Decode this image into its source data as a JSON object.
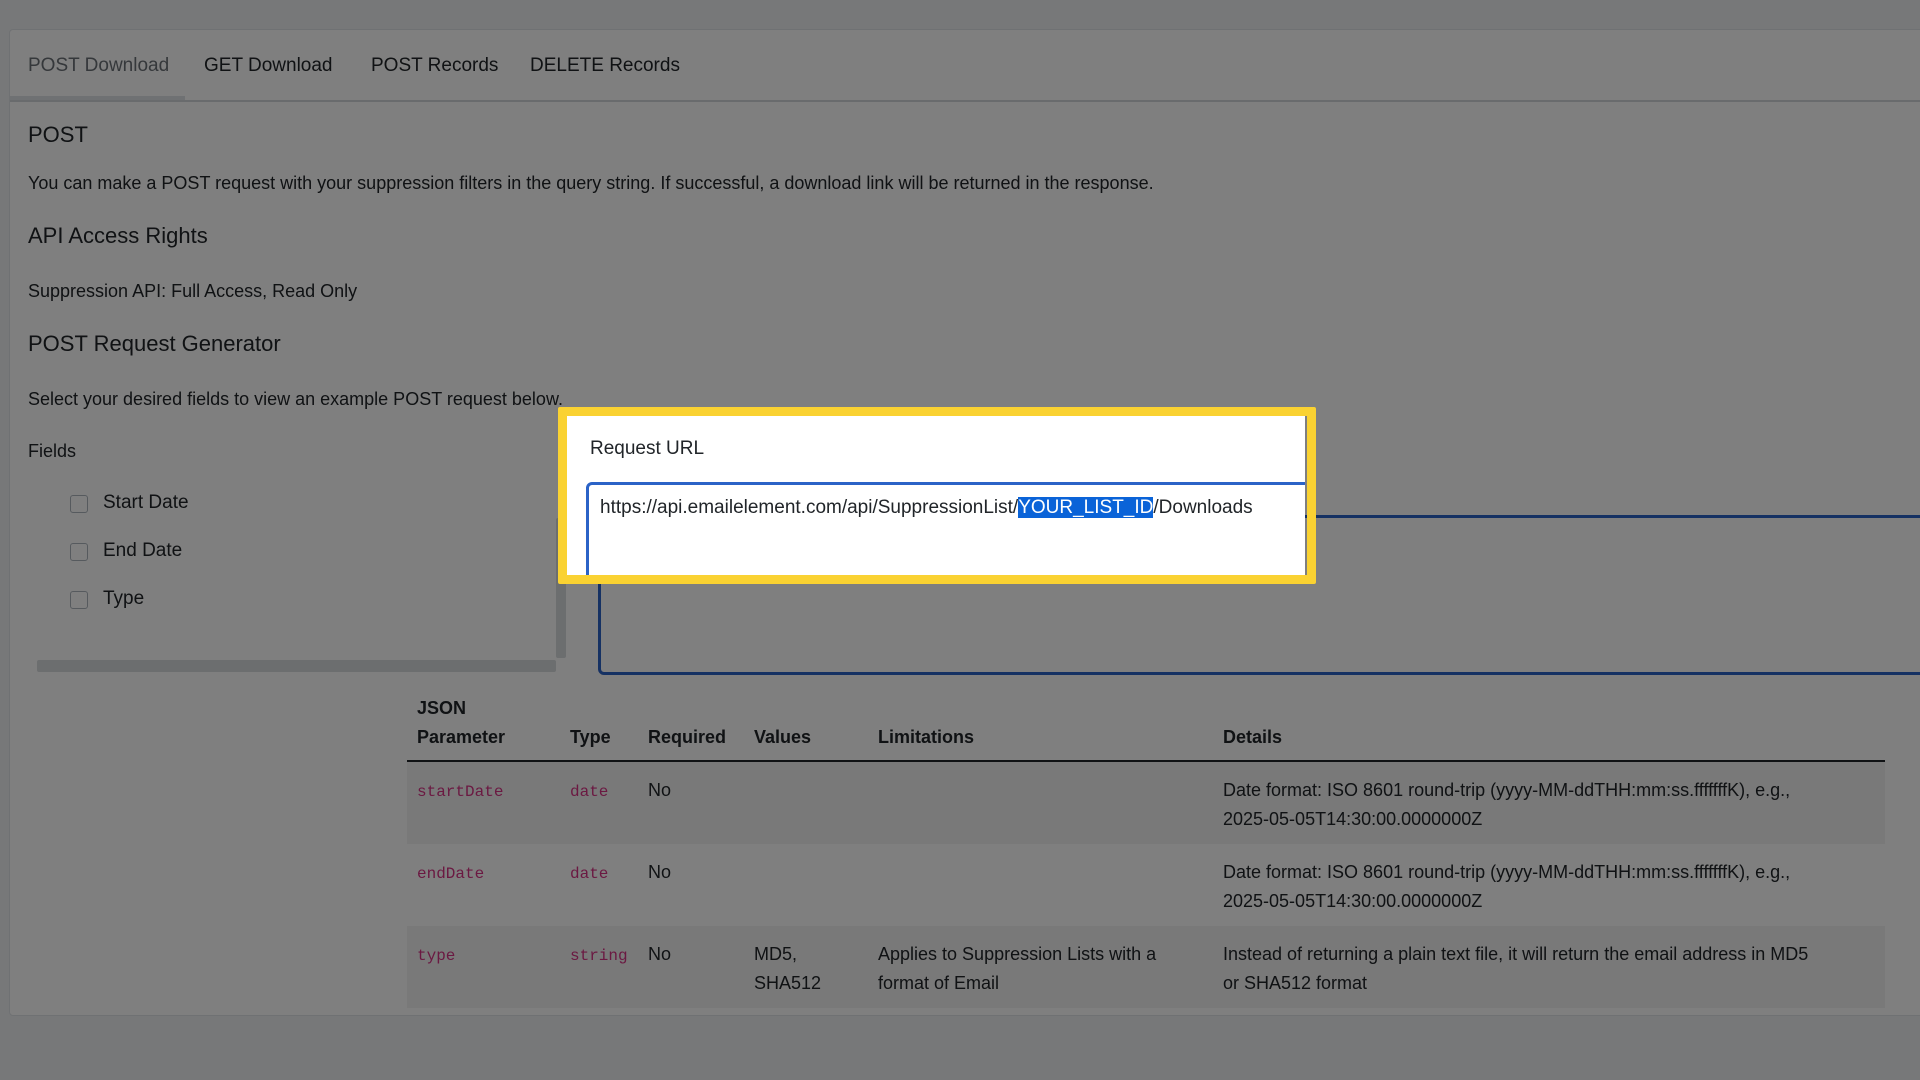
{
  "tabs": [
    {
      "label": "POST Download",
      "active": true
    },
    {
      "label": "GET Download",
      "active": false
    },
    {
      "label": "POST Records",
      "active": false
    },
    {
      "label": "DELETE Records",
      "active": false
    }
  ],
  "post_heading": "POST",
  "post_description": "You can make a POST request with your suppression filters in the query string. If successful, a download link will be returned in the response.",
  "access_heading": "API Access Rights",
  "access_text": "Suppression API: Full Access, Read Only",
  "generator_heading": "POST Request Generator",
  "generator_text": "Select your desired fields to view an example POST request below.",
  "fields_label": "Fields",
  "fields": [
    {
      "label": "Start Date",
      "checked": false
    },
    {
      "label": "End Date",
      "checked": false
    },
    {
      "label": "Type",
      "checked": false
    }
  ],
  "request_url": {
    "label": "Request URL",
    "prefix": "https://api.emailelement.com/api/SuppressionList/",
    "selected": "YOUR_LIST_ID",
    "suffix": "/Downloads"
  },
  "table": {
    "headers": {
      "parameter_line1": "JSON",
      "parameter_line2": "Parameter",
      "type": "Type",
      "required": "Required",
      "values": "Values",
      "limitations": "Limitations",
      "details": "Details"
    },
    "rows": [
      {
        "parameter": "startDate",
        "type": "date",
        "required": "No",
        "values": "",
        "limitations": "",
        "details_line1": "Date format: ISO 8601 round-trip (yyyy-MM-ddTHH:mm:ss.fffffffK), e.g.,",
        "details_line2": "2025-05-05T14:30:00.0000000Z"
      },
      {
        "parameter": "endDate",
        "type": "date",
        "required": "No",
        "values": "",
        "limitations": "",
        "details_line1": "Date format: ISO 8601 round-trip (yyyy-MM-ddTHH:mm:ss.fffffffK), e.g.,",
        "details_line2": "2025-05-05T14:30:00.0000000Z"
      },
      {
        "parameter": "type",
        "type": "string",
        "required": "No",
        "values_line1": "MD5,",
        "values_line2": "SHA512",
        "limitations_line1": "Applies to Suppression Lists with a",
        "limitations_line2": "format of Email",
        "details_line1": "Instead of returning a plain text file, it will return the email address in MD5",
        "details_line2": "or SHA512 format"
      }
    ]
  },
  "colors": {
    "highlight_border": "#fad232",
    "selection": "#0a63d8",
    "code": "#d63384",
    "focus_border": "#2b63c7"
  }
}
